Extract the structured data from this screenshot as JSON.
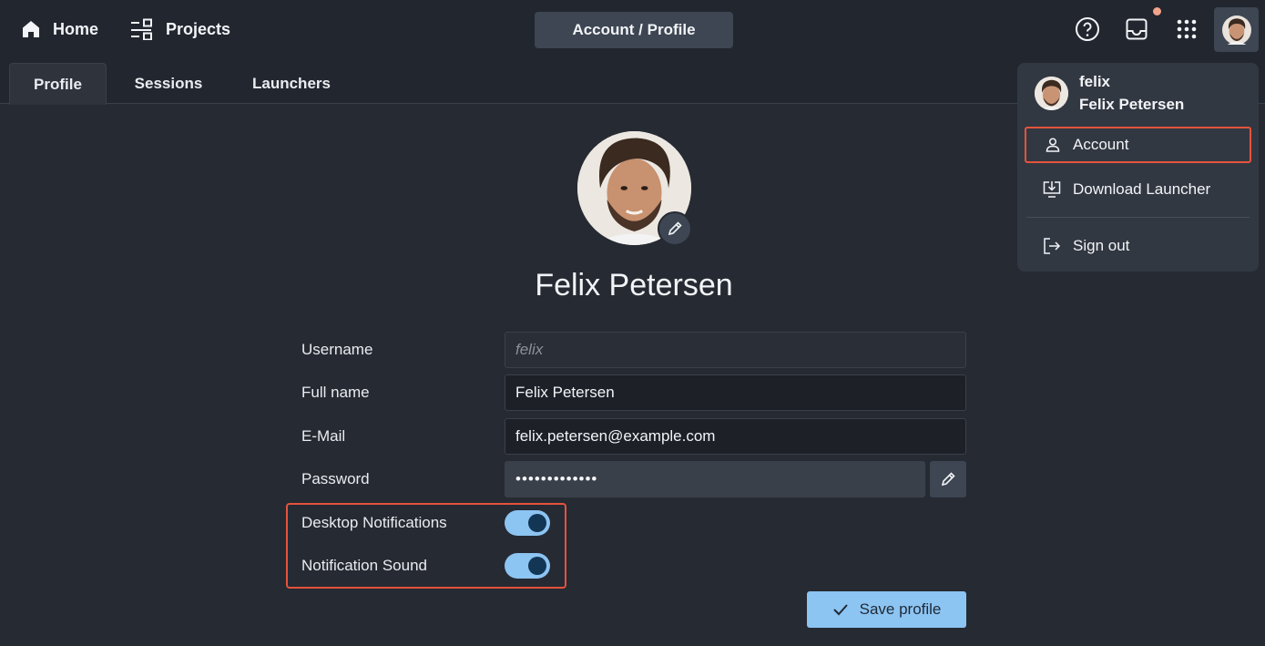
{
  "topbar": {
    "home_label": "Home",
    "projects_label": "Projects",
    "breadcrumb": "Account / Profile"
  },
  "tabs": [
    {
      "label": "Profile",
      "active": true
    },
    {
      "label": "Sessions",
      "active": false
    },
    {
      "label": "Launchers",
      "active": false
    }
  ],
  "profile": {
    "display_name": "Felix Petersen",
    "fields": {
      "username_label": "Username",
      "username_value": "felix",
      "fullname_label": "Full name",
      "fullname_value": "Felix Petersen",
      "email_label": "E-Mail",
      "email_value": "felix.petersen@example.com",
      "password_label": "Password",
      "password_value": "•••••••••••••"
    },
    "toggles": {
      "desktop_label": "Desktop Notifications",
      "desktop_on": true,
      "sound_label": "Notification Sound",
      "sound_on": true
    },
    "save_label": "Save profile"
  },
  "user_menu": {
    "username": "felix",
    "fullname": "Felix Petersen",
    "items": {
      "account": "Account",
      "download": "Download Launcher",
      "signout": "Sign out"
    }
  },
  "colors": {
    "accent": "#8cc4f2",
    "highlight": "#e5533c",
    "notification_dot": "#f2a48a"
  }
}
